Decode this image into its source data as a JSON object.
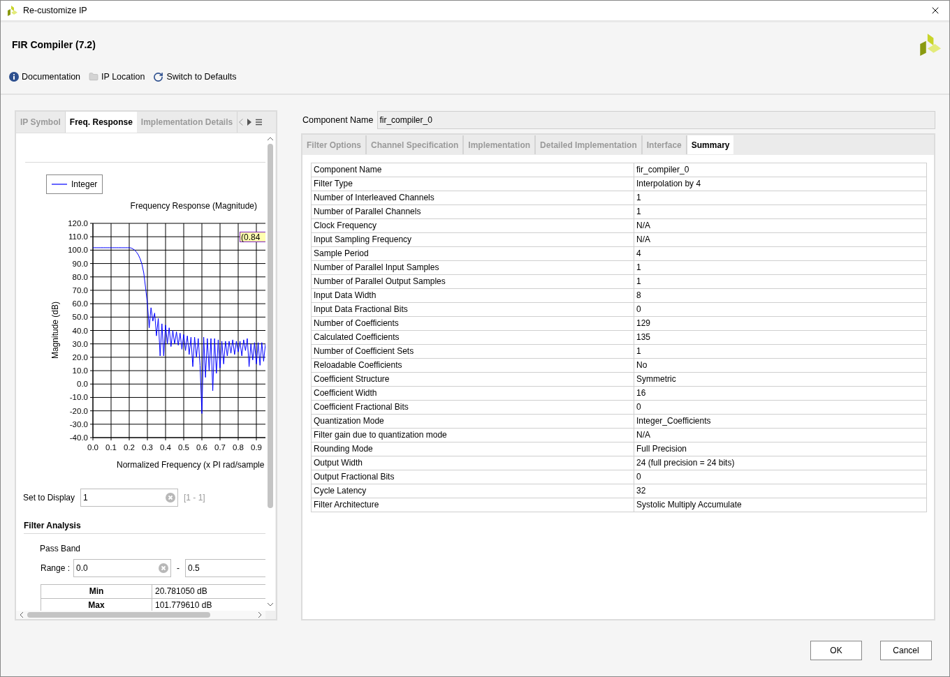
{
  "window": {
    "title": "Re-customize IP"
  },
  "header": {
    "title": "FIR Compiler (7.2)"
  },
  "toolbar": [
    {
      "label": "Documentation",
      "kind": "info"
    },
    {
      "label": "IP Location",
      "kind": "folder"
    },
    {
      "label": "Switch to Defaults",
      "kind": "reset"
    }
  ],
  "left_panel": {
    "tabs": [
      {
        "label": "IP Symbol",
        "selected": false
      },
      {
        "label": "Freq. Response",
        "selected": true
      },
      {
        "label": "Implementation Details",
        "selected": false
      }
    ],
    "chart_data": {
      "type": "line",
      "title": "Frequency Response (Magnitude)",
      "xlabel": "Normalized Frequency (x PI rad/sample",
      "ylabel": "Magnitude (dB)",
      "x": [
        0,
        0.01,
        0.02,
        0.03,
        0.04,
        0.05,
        0.06,
        0.07,
        0.08,
        0.09,
        0.1,
        0.11,
        0.12,
        0.13,
        0.14,
        0.15,
        0.16,
        0.17,
        0.18,
        0.19,
        0.2,
        0.21,
        0.22,
        0.23,
        0.24,
        0.25,
        0.26,
        0.27,
        0.28,
        0.29,
        0.3,
        0.31,
        0.32,
        0.33,
        0.34,
        0.35,
        0.36,
        0.37,
        0.38,
        0.39,
        0.4,
        0.41,
        0.42,
        0.43,
        0.44,
        0.45,
        0.46,
        0.47,
        0.48,
        0.49,
        0.5,
        0.51,
        0.52,
        0.53,
        0.54,
        0.55,
        0.56,
        0.57,
        0.58,
        0.59,
        0.6,
        0.61,
        0.62,
        0.63,
        0.64,
        0.65,
        0.66,
        0.67,
        0.68,
        0.69,
        0.7,
        0.71,
        0.72,
        0.73,
        0.74,
        0.75,
        0.76,
        0.77,
        0.78,
        0.79,
        0.8,
        0.81,
        0.82,
        0.83,
        0.84,
        0.85,
        0.86,
        0.87,
        0.88,
        0.89,
        0.9,
        0.91,
        0.92,
        0.93,
        0.94,
        0.95
      ],
      "series": [
        {
          "name": "Integer",
          "color": "#0000ff",
          "values": [
            101.8,
            101.8,
            101.8,
            101.8,
            101.8,
            101.8,
            101.8,
            101.8,
            101.8,
            101.8,
            101.8,
            101.8,
            101.8,
            101.8,
            101.8,
            101.8,
            101.8,
            101.8,
            101.8,
            101.8,
            101.8,
            101.6,
            101.0,
            100.0,
            98.5,
            96.5,
            93.5,
            89.5,
            83,
            72,
            60,
            42,
            57,
            47,
            53,
            36,
            49,
            21,
            45,
            21,
            44,
            30,
            42,
            28,
            40,
            30,
            39,
            29,
            38,
            26,
            37,
            25,
            36,
            22,
            35,
            13,
            35,
            20,
            34,
            14,
            -22,
            35,
            5,
            34,
            10,
            34,
            -5,
            34,
            8,
            33,
            12,
            32,
            15,
            32,
            21,
            32,
            23,
            33,
            22,
            32,
            24,
            32,
            21,
            33,
            25,
            34,
            13,
            30,
            18,
            31,
            15,
            31,
            14,
            31,
            17,
            30
          ]
        }
      ],
      "xlim": [
        0,
        0.95
      ],
      "ylim": [
        -40,
        120
      ],
      "xticks": [
        {
          "value": 0,
          "label": "0.0"
        },
        {
          "value": 0.1,
          "label": "0.1"
        },
        {
          "value": 0.2,
          "label": "0.2"
        },
        {
          "value": 0.3,
          "label": "0.3"
        },
        {
          "value": 0.4,
          "label": "0.4"
        },
        {
          "value": 0.5,
          "label": "0.5"
        },
        {
          "value": 0.6,
          "label": "0.6"
        },
        {
          "value": 0.7,
          "label": "0.7"
        },
        {
          "value": 0.8,
          "label": "0.8"
        },
        {
          "value": 0.9,
          "label": "0.9"
        }
      ],
      "yticks": [
        {
          "value": 120,
          "label": "120.0"
        },
        {
          "value": 110,
          "label": "110.0"
        },
        {
          "value": 100,
          "label": "100.0"
        },
        {
          "value": 90,
          "label": "90.0"
        },
        {
          "value": 80,
          "label": "80.0"
        },
        {
          "value": 70,
          "label": "70.0"
        },
        {
          "value": 60,
          "label": "60.0"
        },
        {
          "value": 50,
          "label": "50.0"
        },
        {
          "value": 40,
          "label": "40.0"
        },
        {
          "value": 30,
          "label": "30.0"
        },
        {
          "value": 20,
          "label": "20.0"
        },
        {
          "value": 10,
          "label": "10.0"
        },
        {
          "value": 0,
          "label": "0.0"
        },
        {
          "value": -10,
          "label": "-10.0"
        },
        {
          "value": -20,
          "label": "-20.0"
        },
        {
          "value": -30,
          "label": "-30.0"
        },
        {
          "value": -40,
          "label": "-40.0"
        }
      ],
      "annotations": [
        "(0.84"
      ],
      "grid": true
    },
    "set_to_display": {
      "label": "Set to Display",
      "value": "1",
      "range": "[1 - 1]"
    },
    "filter_analysis": {
      "title": "Filter Analysis",
      "pass_band": "Pass Band",
      "range_label": "Range :",
      "range_from": "0.0",
      "range_separator": "-",
      "range_to": "0.5",
      "stats": [
        {
          "name": "Min",
          "value": "20.781050 dB"
        },
        {
          "name": "Max",
          "value": "101.779610 dB"
        }
      ]
    }
  },
  "component_name": {
    "label": "Component Name",
    "value": "fir_compiler_0"
  },
  "config_tabs": [
    {
      "label": "Filter Options",
      "selected": false
    },
    {
      "label": "Channel Specification",
      "selected": false
    },
    {
      "label": "Implementation",
      "selected": false
    },
    {
      "label": "Detailed Implementation",
      "selected": false
    },
    {
      "label": "Interface",
      "selected": false
    },
    {
      "label": "Summary",
      "selected": true
    }
  ],
  "summary": [
    {
      "name": "Component Name",
      "value": "fir_compiler_0"
    },
    {
      "name": "Filter Type",
      "value": "Interpolation by 4"
    },
    {
      "name": "Number of Interleaved Channels",
      "value": "1"
    },
    {
      "name": "Number of Parallel Channels",
      "value": "1"
    },
    {
      "name": "Clock Frequency",
      "value": "N/A"
    },
    {
      "name": "Input Sampling Frequency",
      "value": "N/A"
    },
    {
      "name": "Sample Period",
      "value": "4"
    },
    {
      "name": "Number of Parallel Input Samples",
      "value": "1"
    },
    {
      "name": "Number of Parallel Output Samples",
      "value": "1"
    },
    {
      "name": "Input Data Width",
      "value": "8"
    },
    {
      "name": "Input Data Fractional Bits",
      "value": "0"
    },
    {
      "name": "Number of Coefficients",
      "value": "129"
    },
    {
      "name": "Calculated Coefficients",
      "value": "135"
    },
    {
      "name": "Number of Coefficient Sets",
      "value": "1"
    },
    {
      "name": "Reloadable Coefficients",
      "value": "No"
    },
    {
      "name": "Coefficient Structure",
      "value": "Symmetric"
    },
    {
      "name": "Coefficient Width",
      "value": "16"
    },
    {
      "name": "Coefficient Fractional Bits",
      "value": "0"
    },
    {
      "name": "Quantization Mode",
      "value": "Integer_Coefficients"
    },
    {
      "name": "Filter gain due to quantization mode",
      "value": "N/A"
    },
    {
      "name": "Rounding Mode",
      "value": "Full Precision"
    },
    {
      "name": "Output Width",
      "value": "24 (full precision = 24 bits)"
    },
    {
      "name": "Output Fractional Bits",
      "value": "0"
    },
    {
      "name": "Cycle Latency",
      "value": "32"
    },
    {
      "name": "Filter Architecture",
      "value": "Systolic Multiply Accumulate"
    }
  ],
  "buttons": [
    "OK",
    "Cancel"
  ]
}
